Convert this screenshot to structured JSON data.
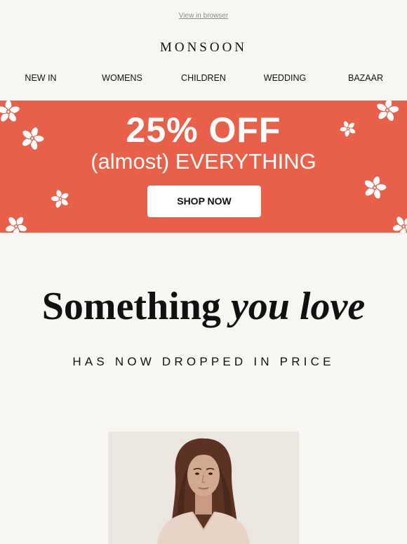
{
  "header": {
    "view_in_browser": "View in browser",
    "logo": "MONSOON"
  },
  "nav": {
    "items": [
      "NEW IN",
      "WOMENS",
      "CHILDREN",
      "WEDDING",
      "BAZAAR"
    ]
  },
  "banner": {
    "headline": "25% OFF",
    "subline": "(almost) EVERYTHING",
    "button_label": "SHOP NOW",
    "background_color": "#e8604a"
  },
  "main": {
    "headline_regular": "Something",
    "headline_italic": "you love",
    "subheading": "HAS NOW DROPPED IN PRICE"
  },
  "product": {
    "image_icon": "model-photo"
  }
}
